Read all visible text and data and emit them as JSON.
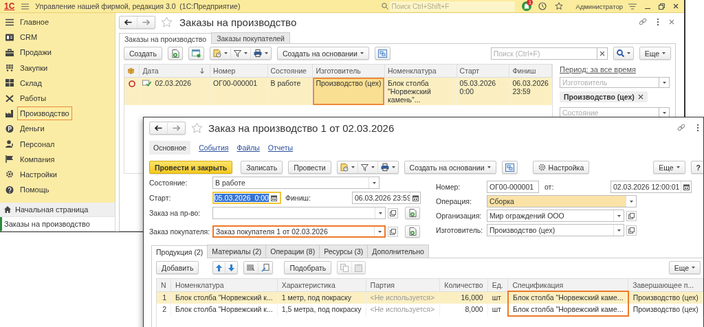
{
  "app": {
    "logo": "1С",
    "title": "Управление нашей фирмой, редакция 3.0  (1С:Предприятие)",
    "search_placeholder": "Поиск Ctrl+Shift+F",
    "notifications": "1",
    "user": "Администратор"
  },
  "sidebar": {
    "sections": [
      {
        "label": "Главное",
        "highlighted": false
      },
      {
        "label": "CRM",
        "highlighted": false
      },
      {
        "label": "Продажи",
        "highlighted": false
      },
      {
        "label": "Закупки",
        "highlighted": false
      },
      {
        "label": "Склад",
        "highlighted": false
      },
      {
        "label": "Работы",
        "highlighted": false
      },
      {
        "label": "Производство",
        "highlighted": true
      },
      {
        "label": "Деньги",
        "highlighted": false
      },
      {
        "label": "Персонал",
        "highlighted": false
      },
      {
        "label": "Компания",
        "highlighted": false
      },
      {
        "label": "Настройки",
        "highlighted": false
      },
      {
        "label": "Помощь",
        "highlighted": false
      }
    ],
    "open_windows": [
      {
        "label": "Начальная страница",
        "selected": false
      },
      {
        "label": "Заказы на производство",
        "selected": true
      }
    ]
  },
  "list_window": {
    "title": "Заказы на производство",
    "tabs": [
      {
        "label": "Заказы на производство",
        "selected": true
      },
      {
        "label": "Заказы покупателей",
        "selected": false
      }
    ],
    "toolbar": {
      "create": "Создать",
      "create_based_on": "Создать на основании",
      "search_placeholder": "Поиск (Ctrl+F)",
      "more": "Еще"
    },
    "table": {
      "columns": [
        {
          "label": "Дата",
          "highlighted": false
        },
        {
          "label": "Номер",
          "highlighted": false
        },
        {
          "label": "Состояние",
          "highlighted": false
        },
        {
          "label": "Изготовитель",
          "highlighted": true
        },
        {
          "label": "Номенклатура",
          "highlighted": false
        },
        {
          "label": "Старт",
          "highlighted": false
        },
        {
          "label": "Финиш",
          "highlighted": false
        }
      ],
      "rows": [
        {
          "cells": [
            "02.03.2026",
            "ОГ00-000001",
            "В работе",
            "Производство (цех)",
            "Блок столба \"Норвежский камень\"...",
            "05.03.2026 0:00",
            "06.03.2026 23:59"
          ],
          "selected": true
        }
      ]
    },
    "filters": {
      "period": "Период: за все время",
      "maker_placeholder": "Изготовитель",
      "tag": "Производство (цех)",
      "state_placeholder": "Состояние"
    }
  },
  "dialog": {
    "title": "Заказ на производство 1 от 02.03.2026",
    "nav": [
      {
        "label": "Основное",
        "selected": true
      },
      {
        "label": "События",
        "selected": false
      },
      {
        "label": "Файлы",
        "selected": false
      },
      {
        "label": "Отчеты",
        "selected": false
      }
    ],
    "toolbar": {
      "post_close": "Провести и закрыть",
      "save": "Записать",
      "post": "Провести",
      "create_based_on": "Создать на основании",
      "settings": "Настройка",
      "more": "Еще",
      "help": "?"
    },
    "fields": {
      "state": {
        "label": "Состояние:",
        "value": "В работе"
      },
      "start": {
        "label": "Старт:",
        "value": "05.03.2026  0:00",
        "focused": true
      },
      "finish": {
        "label": "Финиш:",
        "value": "06.03.2026 23:59"
      },
      "production_order": {
        "label": "Заказ на пр-во:"
      },
      "customer_order": {
        "label": "Заказ покупателя:",
        "value": "Заказ покупателя 1 от 02.03.2026",
        "highlighted": true
      },
      "number": {
        "label": "Номер:",
        "value": "ОГ00-000001"
      },
      "date": {
        "label": "от:",
        "value": "02.03.2026 12:00:01"
      },
      "operation": {
        "label": "Операция:",
        "value": "Сборка",
        "accented": true
      },
      "organization": {
        "label": "Организация:",
        "value": "Мир ограждений ООО"
      },
      "maker": {
        "label": "Изготовитель:",
        "value": "Производство (цех)"
      }
    },
    "tabs": [
      {
        "label": "Продукция (2)",
        "selected": true
      },
      {
        "label": "Материалы (2)",
        "selected": false
      },
      {
        "label": "Операции (8)",
        "selected": false
      },
      {
        "label": "Ресурсы (3)",
        "selected": false
      },
      {
        "label": "Дополнительно",
        "selected": false
      }
    ],
    "table_toolbar": {
      "add": "Добавить",
      "pick": "Подобрать",
      "more": "Еще"
    },
    "table": {
      "columns": [
        {
          "label": "N",
          "highlighted": false
        },
        {
          "label": "Номенклатура",
          "highlighted": false
        },
        {
          "label": "Характеристика",
          "highlighted": false
        },
        {
          "label": "Партия",
          "highlighted": false
        },
        {
          "label": "Количество",
          "highlighted": false
        },
        {
          "label": "Ед.",
          "highlighted": false
        },
        {
          "label": "Спецификация",
          "highlighted": true
        },
        {
          "label": "Завершающее п...",
          "highlighted": false
        }
      ],
      "rows": [
        {
          "cells": [
            "1",
            "Блок столба \"Норвежский к...",
            "1 метр, под покраску",
            "<Не используется>",
            "16,000",
            "шт",
            "Блок столба \"Норвежский каме...",
            "Производство (цех)"
          ],
          "selected": true
        },
        {
          "cells": [
            "2",
            "Блок столба \"Норвежский к...",
            "1,5 метра, под покраску",
            "<Не используется>",
            "8,000",
            "шт",
            "Блок столба \"Норвежский каме...",
            "Производство (цех)"
          ],
          "selected": false
        }
      ]
    }
  }
}
